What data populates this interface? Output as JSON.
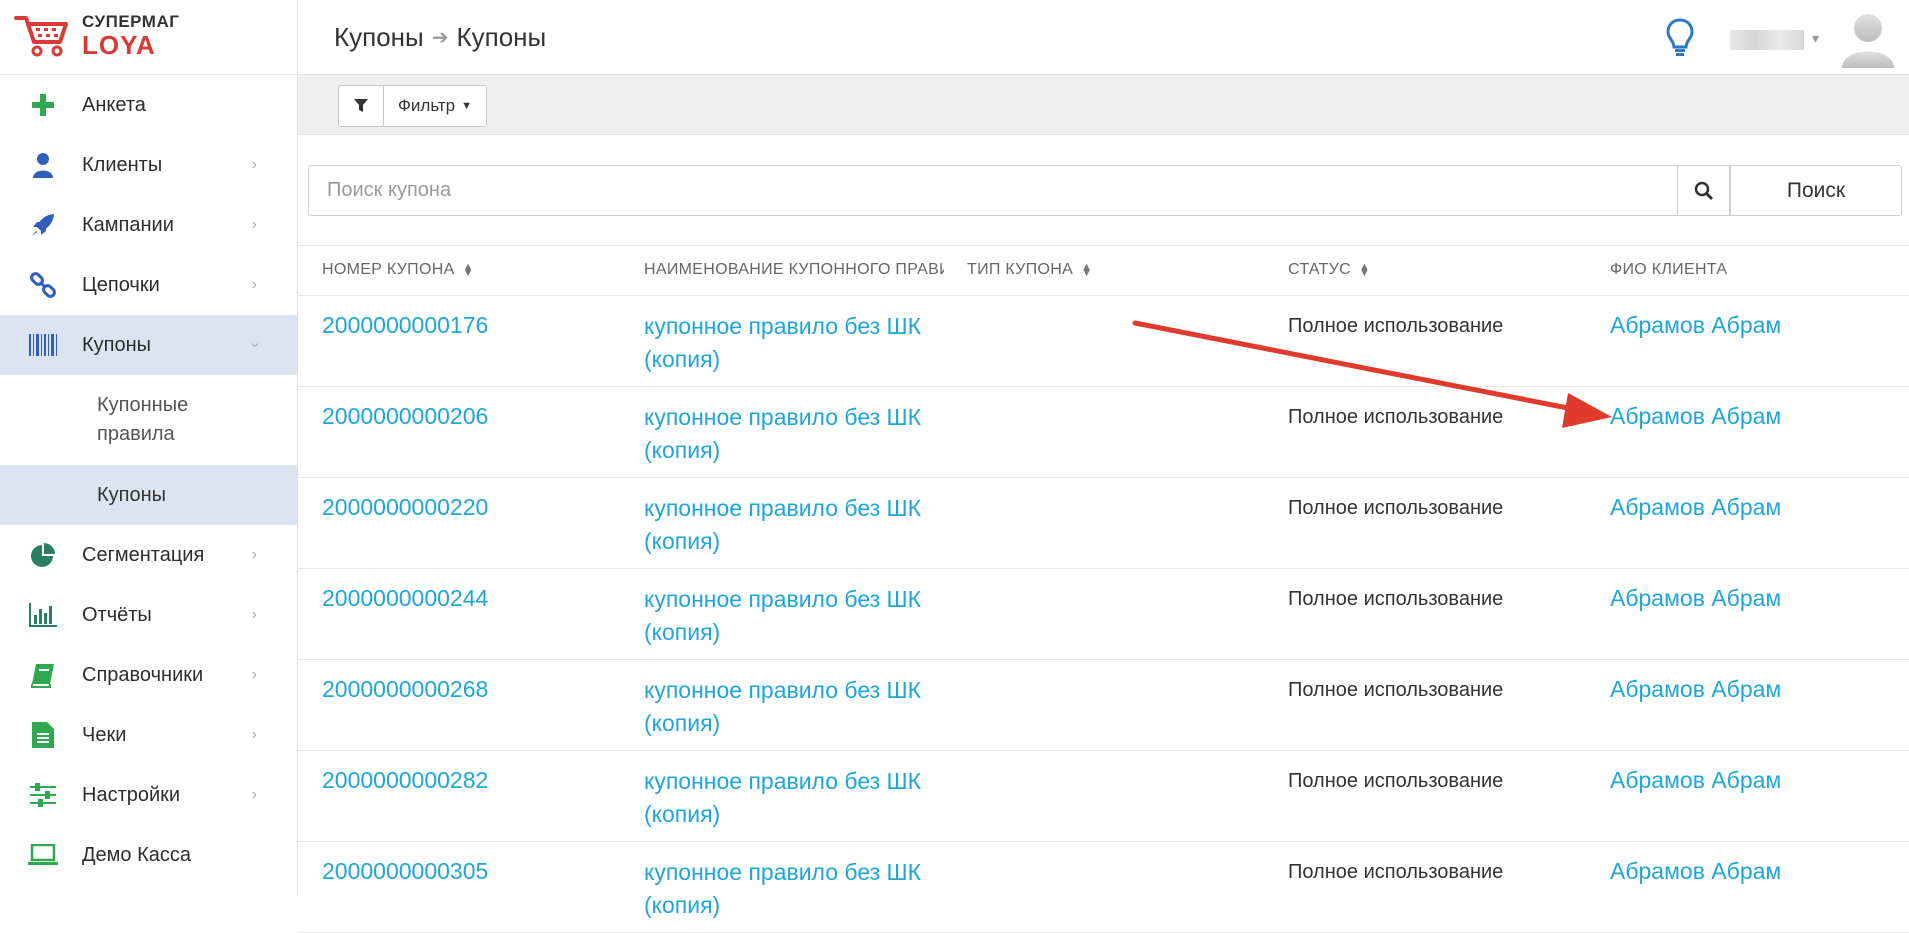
{
  "app": {
    "brand_top": "СУПЕРМАГ",
    "brand_bottom": "LOYA"
  },
  "header": {
    "breadcrumb": [
      "Купоны",
      "Купоны"
    ]
  },
  "sidebar": {
    "items": [
      {
        "label": "Анкета",
        "icon": "plus-icon"
      },
      {
        "label": "Клиенты",
        "icon": "user-icon"
      },
      {
        "label": "Кампании",
        "icon": "rocket-icon"
      },
      {
        "label": "Цепочки",
        "icon": "link-icon"
      },
      {
        "label": "Купоны",
        "icon": "barcode-icon"
      },
      {
        "label": "Сегментация",
        "icon": "pie-chart-icon"
      },
      {
        "label": "Отчёты",
        "icon": "bar-chart-icon"
      },
      {
        "label": "Справочники",
        "icon": "book-icon"
      },
      {
        "label": "Чеки",
        "icon": "receipt-icon"
      },
      {
        "label": "Настройки",
        "icon": "sliders-icon"
      },
      {
        "label": "Демо Касса",
        "icon": "laptop-icon"
      }
    ],
    "sub_items": [
      "Купонные правила",
      "Купоны"
    ]
  },
  "toolbar": {
    "filter_label": "Фильтр"
  },
  "search": {
    "placeholder": "Поиск купона",
    "button_label": "Поиск"
  },
  "table": {
    "columns": [
      "НОМЕР КУПОНА",
      "НАИМЕНОВАНИЕ КУПОННОГО ПРАВИ",
      "ТИП КУПОНА",
      "СТАТУС",
      "ФИО КЛИЕНТА"
    ],
    "rows": [
      {
        "number": "2000000000176",
        "rule": "купонное правило без ШК (копия)",
        "type": "",
        "status": "Полное использование",
        "client": "Абрамов Абрам"
      },
      {
        "number": "2000000000206",
        "rule": "купонное правило без ШК (копия)",
        "type": "",
        "status": "Полное использование",
        "client": "Абрамов Абрам"
      },
      {
        "number": "2000000000220",
        "rule": "купонное правило без ШК (копия)",
        "type": "",
        "status": "Полное использование",
        "client": "Абрамов Абрам"
      },
      {
        "number": "2000000000244",
        "rule": "купонное правило без ШК (копия)",
        "type": "",
        "status": "Полное использование",
        "client": "Абрамов Абрам"
      },
      {
        "number": "2000000000268",
        "rule": "купонное правило без ШК (копия)",
        "type": "",
        "status": "Полное использование",
        "client": "Абрамов Абрам"
      },
      {
        "number": "2000000000282",
        "rule": "купонное правило без ШК (копия)",
        "type": "",
        "status": "Полное использование",
        "client": "Абрамов Абрам"
      },
      {
        "number": "2000000000305",
        "rule": "купонное правило без ШК (копия)",
        "type": "",
        "status": "Полное использование",
        "client": "Абрамов Абрам"
      }
    ]
  },
  "colors": {
    "accent": "#1fa6d8",
    "brand_red": "#d83a35",
    "icon_green": "#2fa84f",
    "active_bg": "#dce3f1",
    "annotation_arrow": "#e03a2c"
  }
}
